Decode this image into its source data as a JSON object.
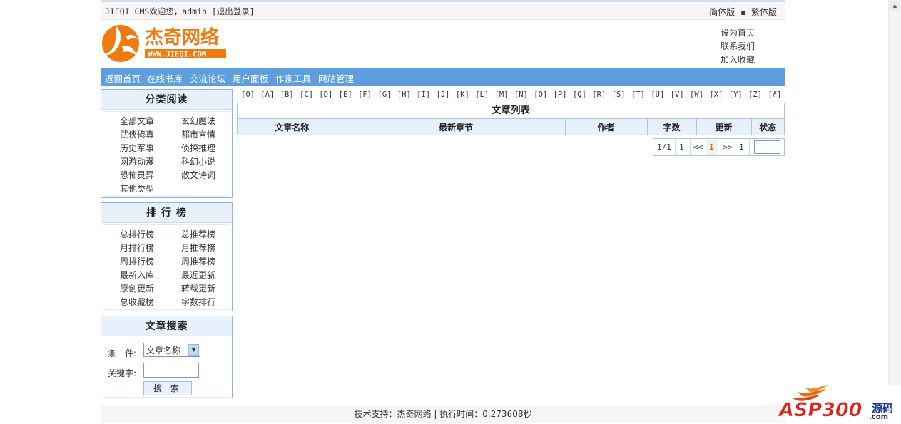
{
  "topbar": {
    "welcome_prefix": "JIEQI CMS欢迎您，admin ",
    "logout": "[退出登录]",
    "lang_simplified": "简体版",
    "lang_dot": "▪",
    "lang_traditional": "繁体版"
  },
  "logo": {
    "main_text": "杰奇网络",
    "sub_text": "WWW.JIEQI.COM"
  },
  "quick_links": [
    "设为首页",
    "联系我们",
    "加入收藏"
  ],
  "nav": [
    "返回首页",
    "在线书库",
    "交流论坛",
    "用户面板",
    "作家工具",
    "网站管理"
  ],
  "category_box": {
    "title": "分类阅读",
    "rows": [
      [
        "全部文章",
        "玄幻魔法"
      ],
      [
        "武侠修真",
        "都市言情"
      ],
      [
        "历史军事",
        "侦探推理"
      ],
      [
        "网游动漫",
        "科幻小说"
      ],
      [
        "恐怖灵异",
        "散文诗词"
      ],
      [
        "其他类型",
        ""
      ]
    ]
  },
  "rank_box": {
    "title": "排 行 榜",
    "rows": [
      [
        "总排行榜",
        "总推荐榜"
      ],
      [
        "月排行榜",
        "月推荐榜"
      ],
      [
        "周排行榜",
        "周推荐榜"
      ],
      [
        "最新入库",
        "最近更新"
      ],
      [
        "原创更新",
        "转载更新"
      ],
      [
        "总收藏榜",
        "字数排行"
      ]
    ]
  },
  "search_box": {
    "title": "文章搜索",
    "condition_label": "条　件:",
    "condition_value": "文章名称",
    "keyword_label": "关键字:",
    "button": "搜 索"
  },
  "letters": [
    "[0]",
    "[A]",
    "[B]",
    "[C]",
    "[D]",
    "[E]",
    "[F]",
    "[G]",
    "[H]",
    "[I]",
    "[J]",
    "[K]",
    "[L]",
    "[M]",
    "[N]",
    "[O]",
    "[P]",
    "[Q]",
    "[R]",
    "[S]",
    "[T]",
    "[U]",
    "[V]",
    "[W]",
    "[X]",
    "[Y]",
    "[Z]",
    "[#]"
  ],
  "article_list": {
    "title": "文章列表",
    "columns": [
      "文章名称",
      "最新章节",
      "作者",
      "字数",
      "更新",
      "状态"
    ]
  },
  "pager": {
    "page_of": "1/1",
    "first": "1",
    "prev": "<<",
    "current": "1",
    "next": ">>",
    "last": "1"
  },
  "footer": "技术支持：杰奇网络 | 执行时间：0.273608秒",
  "watermark": {
    "brand": "ASP300",
    "cn": "源码",
    "domain": ".com"
  },
  "colors": {
    "nav_bg": "#5c9ee0",
    "box_border": "#8db8e0",
    "box_title_bg": "#e8f1fb",
    "logo_orange": "#f07a10"
  }
}
